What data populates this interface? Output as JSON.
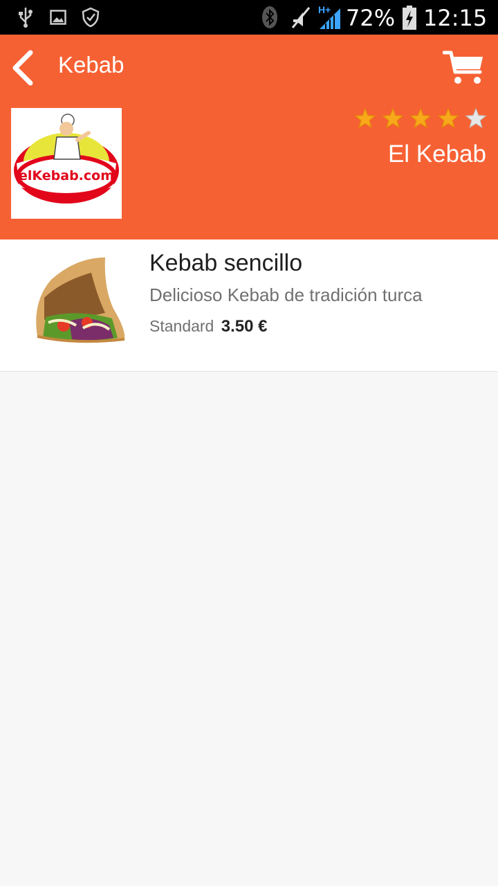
{
  "status_bar": {
    "battery": "72%",
    "time": "12:15",
    "network_type": "H+",
    "icons": [
      "usb-icon",
      "image-icon",
      "shield-icon",
      "bluetooth-icon",
      "mute-icon",
      "signal-icon",
      "battery-charging-icon"
    ]
  },
  "header": {
    "back_icon": "chevron-left-icon",
    "title": "Kebab",
    "cart_icon": "cart-icon",
    "restaurant": {
      "logo_text": "elKebab.com",
      "rating": 4,
      "rating_max": 5,
      "name": "El Kebab"
    }
  },
  "products": [
    {
      "name": "Kebab sencillo",
      "description": "Delicioso Kebab de tradición turca",
      "size": "Standard",
      "price": "3.50 €"
    }
  ],
  "colors": {
    "accent": "#f66134",
    "star_filled": "#f7a81b",
    "star_empty": "#e6e6e6",
    "background": "#f7f7f7"
  }
}
